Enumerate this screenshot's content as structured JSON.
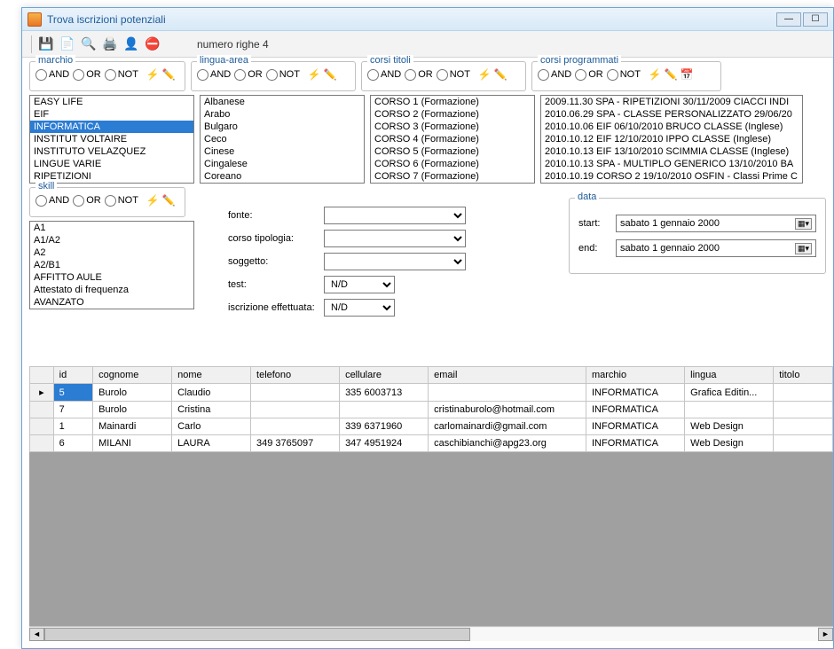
{
  "window": {
    "title": "Trova iscrizioni potenziali"
  },
  "toolbar": {
    "row_count": "numero righe 4"
  },
  "logic": {
    "and": "AND",
    "or": "OR",
    "not": "NOT"
  },
  "filters": {
    "marchio": {
      "label": "marchio",
      "items": [
        "EASY LIFE",
        "EIF",
        "INFORMATICA",
        "INSTITUT VOLTAIRE",
        "INSTITUTO VELAZQUEZ",
        "LINGUE VARIE",
        "RIPETIZIONI"
      ],
      "selected": "INFORMATICA"
    },
    "lingua": {
      "label": "lingua-area",
      "items": [
        "Albanese",
        "Arabo",
        "Bulgaro",
        "Ceco",
        "Cinese",
        "Cingalese",
        "Coreano"
      ]
    },
    "corsi_titoli": {
      "label": "corsi titoli",
      "items": [
        "CORSO 1 (Formazione)",
        "CORSO 2 (Formazione)",
        "CORSO 3 (Formazione)",
        "CORSO 4 (Formazione)",
        "CORSO 5 (Formazione)",
        "CORSO 6 (Formazione)",
        "CORSO 7 (Formazione)"
      ]
    },
    "corsi_programmati": {
      "label": "corsi programmati",
      "items": [
        "2009.11.30 SPA - RIPETIZIONI 30/11/2009 CIACCI INDI",
        "2010.06.29 SPA - CLASSE PERSONALIZZATO 29/06/20",
        "2010.10.06 EIF  06/10/2010 BRUCO CLASSE (Inglese)",
        "2010.10.12 EIF  12/10/2010 IPPO CLASSE (Inglese)",
        "2010.10.13 EIF  13/10/2010 SCIMMIA CLASSE (Inglese)",
        "2010.10.13 SPA - MULTIPLO GENERICO 13/10/2010 BA",
        "2010.10.19 CORSO 2 19/10/2010 OSFIN - Classi Prime C"
      ]
    },
    "skill": {
      "label": "skill",
      "items": [
        "A1",
        "A1/A2",
        "A2",
        "A2/B1",
        "AFFITTO AULE",
        "Attestato di frequenza",
        "AVANZATO"
      ]
    }
  },
  "form": {
    "fonte": "fonte:",
    "corso_tipologia": "corso tipologia:",
    "soggetto": "soggetto:",
    "test": "test:",
    "iscrizione": "iscrizione effettuata:",
    "nd": "N/D"
  },
  "data_group": {
    "label": "data",
    "start": "start:",
    "end": "end:",
    "date_value": "sabato    1  gennaio   2000"
  },
  "grid": {
    "headers": [
      "",
      "id",
      "cognome",
      "nome",
      "telefono",
      "cellulare",
      "email",
      "marchio",
      "lingua",
      "titolo"
    ],
    "rows": [
      {
        "id": "5",
        "cognome": "Burolo",
        "nome": "Claudio",
        "telefono": "",
        "cellulare": "335 6003713",
        "email": "",
        "marchio": "INFORMATICA",
        "lingua": "Grafica Editin..."
      },
      {
        "id": "7",
        "cognome": "Burolo",
        "nome": "Cristina",
        "telefono": "",
        "cellulare": "",
        "email": "cristinaburolo@hotmail.com",
        "marchio": "INFORMATICA",
        "lingua": ""
      },
      {
        "id": "1",
        "cognome": "Mainardi",
        "nome": "Carlo",
        "telefono": "",
        "cellulare": "339 6371960",
        "email": "carlomainardi@gmail.com",
        "marchio": "INFORMATICA",
        "lingua": "Web Design"
      },
      {
        "id": "6",
        "cognome": "MILANI",
        "nome": "LAURA",
        "telefono": "349 3765097",
        "cellulare": "347 4951924",
        "email": "caschibianchi@apg23.org",
        "marchio": "INFORMATICA",
        "lingua": "Web Design"
      }
    ]
  }
}
